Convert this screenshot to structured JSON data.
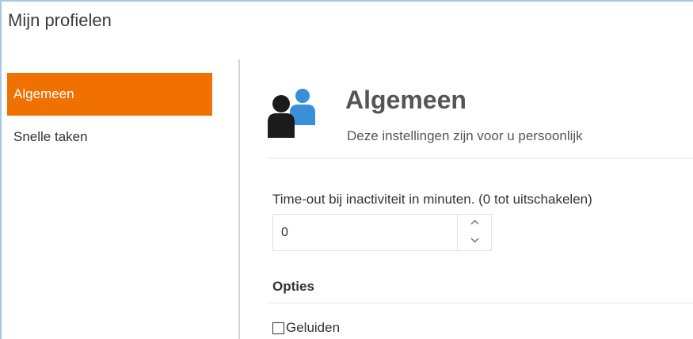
{
  "window": {
    "title": "Mijn profielen"
  },
  "sidebar": {
    "items": [
      {
        "label": "Algemeen",
        "active": true
      },
      {
        "label": "Snelle taken",
        "active": false
      }
    ],
    "accent_color": "#f07000"
  },
  "section": {
    "icon": "users-icon",
    "title": "Algemeen",
    "subtitle": "Deze instellingen zijn voor u persoonlijk"
  },
  "timeout": {
    "label": "Time-out bij inactiviteit in minuten. (0 tot uitschakelen)",
    "value": "0"
  },
  "options": {
    "heading": "Opties",
    "checkboxes": [
      {
        "label": "Geluiden",
        "checked": false
      }
    ]
  }
}
